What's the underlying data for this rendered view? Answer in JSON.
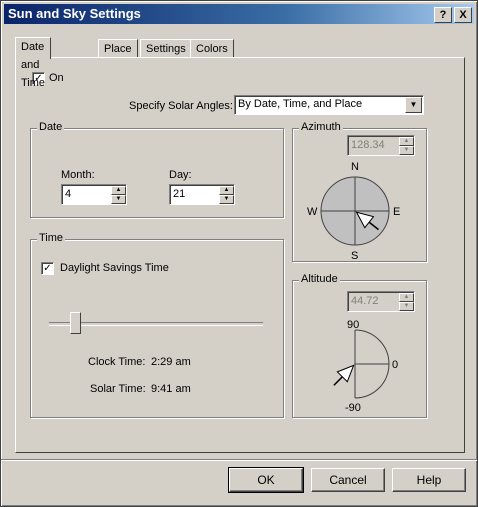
{
  "window": {
    "title": "Sun and Sky Settings",
    "help_label": "?",
    "close_label": "X"
  },
  "tabs": [
    {
      "label": "Date and Time"
    },
    {
      "label": "Place"
    },
    {
      "label": "Settings"
    },
    {
      "label": "Colors"
    }
  ],
  "on_checkbox": {
    "label": "On",
    "checked": true,
    "mark": "✓"
  },
  "solar_angles": {
    "label": "Specify Solar Angles:",
    "selected": "By Date, Time, and Place"
  },
  "date_group": {
    "title": "Date",
    "month_label": "Month:",
    "month_value": "4",
    "day_label": "Day:",
    "day_value": "21"
  },
  "time_group": {
    "title": "Time",
    "dst_label": "Daylight Savings Time",
    "dst_checked": true,
    "mark": "✓",
    "slider_fraction": 0.12,
    "clock_time_label": "Clock Time:",
    "clock_time_value": "2:29 am",
    "solar_time_label": "Solar Time:",
    "solar_time_value": "9:41 am"
  },
  "azimuth_group": {
    "title": "Azimuth",
    "value": "128.34",
    "north": "N",
    "south": "S",
    "east": "E",
    "west": "W"
  },
  "altitude_group": {
    "title": "Altitude",
    "value": "44.72",
    "top": "90",
    "zero": "0",
    "bottom": "-90"
  },
  "footer": {
    "ok_label": "OK",
    "cancel_label": "Cancel",
    "help_label": "Help"
  },
  "colors": {
    "title_start": "#0a246a",
    "face": "#d4d0c8",
    "compass_fill": "#c0c0c0"
  },
  "icons": {
    "spin_up": "▲",
    "spin_down": "▼",
    "dropdown": "▼"
  }
}
